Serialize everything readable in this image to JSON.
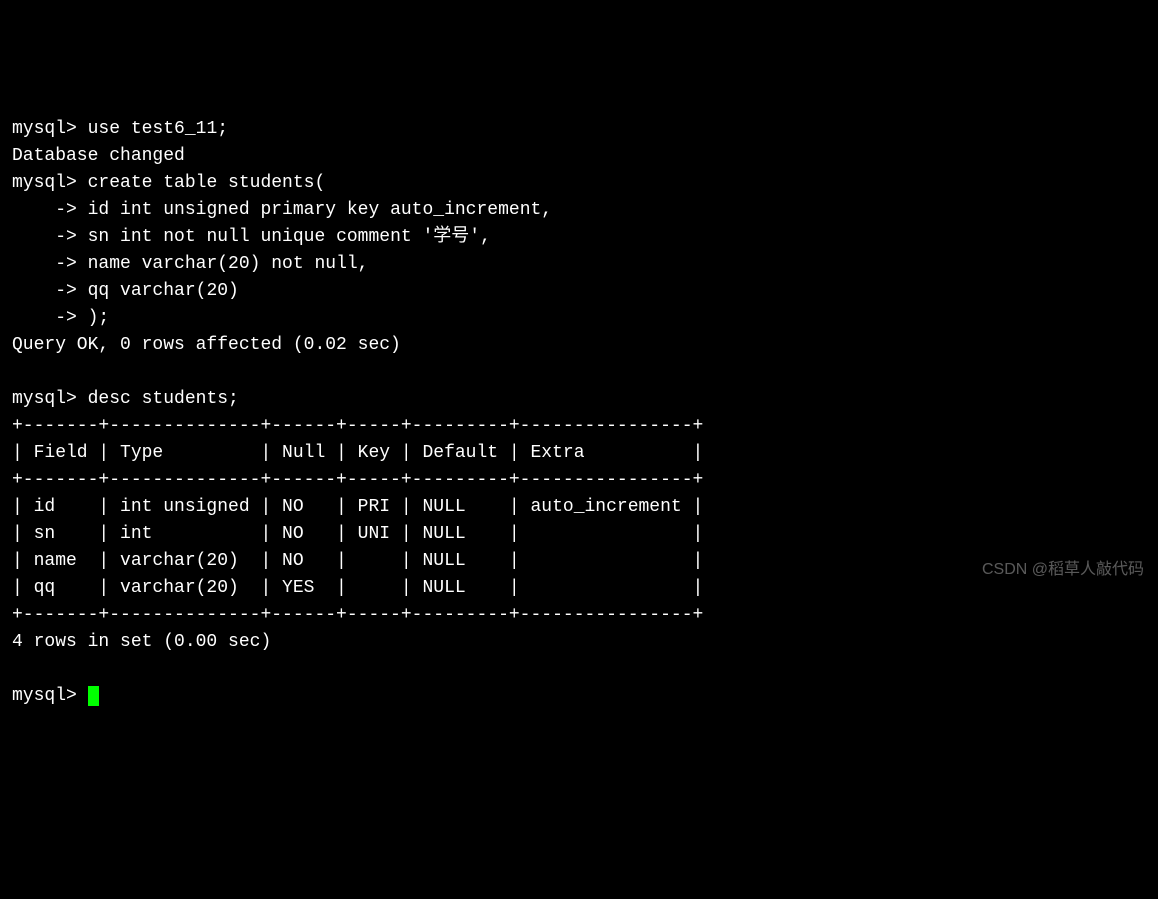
{
  "terminal": {
    "prompt": "mysql>",
    "arrow": "    ->",
    "cmd_use": "use test6_11;",
    "db_changed": "Database changed",
    "cmd_create": "create table students(",
    "line_id": "id int unsigned primary key auto_increment,",
    "line_sn": "sn int not null unique comment '学号',",
    "line_name": "name varchar(20) not null,",
    "line_qq": "qq varchar(20)",
    "line_end": ");",
    "query_ok": "Query OK, 0 rows affected (0.02 sec)",
    "cmd_desc": "desc students;",
    "table_border": "+-------+--------------+------+-----+---------+----------------+",
    "table_header": "| Field | Type         | Null | Key | Default | Extra          |",
    "row_id": "| id    | int unsigned | NO   | PRI | NULL    | auto_increment |",
    "row_sn": "| sn    | int          | NO   | UNI | NULL    |                |",
    "row_name": "| name  | varchar(20)  | NO   |     | NULL    |                |",
    "row_qq": "| qq    | varchar(20)  | YES  |     | NULL    |                |",
    "rows_in_set": "4 rows in set (0.00 sec)"
  },
  "watermark": "CSDN @稻草人敲代码",
  "desc_table": {
    "columns": [
      "Field",
      "Type",
      "Null",
      "Key",
      "Default",
      "Extra"
    ],
    "rows": [
      {
        "Field": "id",
        "Type": "int unsigned",
        "Null": "NO",
        "Key": "PRI",
        "Default": "NULL",
        "Extra": "auto_increment"
      },
      {
        "Field": "sn",
        "Type": "int",
        "Null": "NO",
        "Key": "UNI",
        "Default": "NULL",
        "Extra": ""
      },
      {
        "Field": "name",
        "Type": "varchar(20)",
        "Null": "NO",
        "Key": "",
        "Default": "NULL",
        "Extra": ""
      },
      {
        "Field": "qq",
        "Type": "varchar(20)",
        "Null": "YES",
        "Key": "",
        "Default": "NULL",
        "Extra": ""
      }
    ]
  }
}
